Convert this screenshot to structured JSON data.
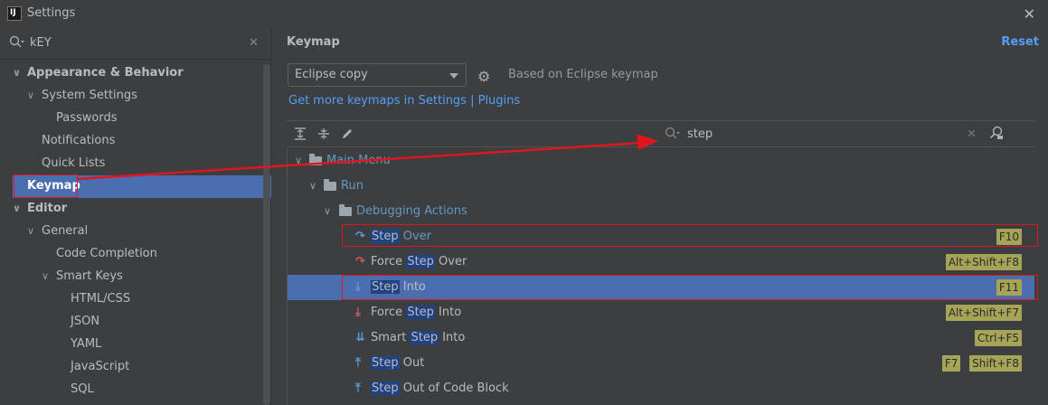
{
  "window": {
    "title": "Settings",
    "app_icon_text": "IJ"
  },
  "sidebar": {
    "search_value": "kEY",
    "items": [
      {
        "label": "Appearance & Behavior",
        "level": 0,
        "expanded": true,
        "bold": true
      },
      {
        "label": "System Settings",
        "level": 1,
        "expanded": true,
        "bold": false
      },
      {
        "label": "Passwords",
        "level": 2,
        "expanded": null,
        "bold": false
      },
      {
        "label": "Notifications",
        "level": 1,
        "expanded": null,
        "bold": false
      },
      {
        "label": "Quick Lists",
        "level": 1,
        "expanded": null,
        "bold": false
      },
      {
        "label": "Keymap",
        "level": 0,
        "expanded": null,
        "bold": true,
        "selected": true
      },
      {
        "label": "Editor",
        "level": 0,
        "expanded": true,
        "bold": true
      },
      {
        "label": "General",
        "level": 1,
        "expanded": true,
        "bold": false
      },
      {
        "label": "Code Completion",
        "level": 2,
        "expanded": null,
        "bold": false
      },
      {
        "label": "Smart Keys",
        "level": 2,
        "expanded": true,
        "bold": false
      },
      {
        "label": "HTML/CSS",
        "level": 3,
        "expanded": null,
        "bold": false
      },
      {
        "label": "JSON",
        "level": 3,
        "expanded": null,
        "bold": false
      },
      {
        "label": "YAML",
        "level": 3,
        "expanded": null,
        "bold": false
      },
      {
        "label": "JavaScript",
        "level": 3,
        "expanded": null,
        "bold": false
      },
      {
        "label": "SQL",
        "level": 3,
        "expanded": null,
        "bold": false
      }
    ]
  },
  "main": {
    "title": "Keymap",
    "reset_label": "Reset",
    "keymap_select": "Eclipse copy",
    "based_on": "Based on Eclipse keymap",
    "more_link": "Get more keymaps in Settings | Plugins",
    "filter_value": "step",
    "tree": {
      "main_menu": "Main Menu",
      "run": "Run",
      "debugging_actions": "Debugging Actions"
    },
    "actions": [
      {
        "prefix": "",
        "match": "Step",
        "suffix": " Over",
        "icon": "step-over-icon",
        "shortcuts": [
          "F10"
        ],
        "boxed": true
      },
      {
        "prefix": "Force ",
        "match": "Step",
        "suffix": " Over",
        "icon": "force-step-over-icon",
        "shortcuts": [
          "Alt+Shift+F8"
        ]
      },
      {
        "prefix": "",
        "match": "Step",
        "suffix": " Into",
        "icon": "step-into-icon",
        "shortcuts": [
          "F11"
        ],
        "selected": true,
        "boxed": true
      },
      {
        "prefix": "Force ",
        "match": "Step",
        "suffix": " Into",
        "icon": "force-step-into-icon",
        "shortcuts": [
          "Alt+Shift+F7"
        ]
      },
      {
        "prefix": "Smart ",
        "match": "Step",
        "suffix": " Into",
        "icon": "smart-step-into-icon",
        "shortcuts": [
          "Ctrl+F5"
        ]
      },
      {
        "prefix": "",
        "match": "Step",
        "suffix": " Out",
        "icon": "step-out-icon",
        "shortcuts": [
          "F7",
          "Shift+F8"
        ]
      },
      {
        "prefix": "",
        "match": "Step",
        "suffix": " Out of Code Block",
        "icon": "step-out-code-block-icon",
        "shortcuts": []
      }
    ]
  },
  "colors": {
    "accent": "#4b6eaf",
    "link": "#589df6",
    "annotation_red": "#e0161e",
    "shortcut_bg": "#a6a557"
  }
}
